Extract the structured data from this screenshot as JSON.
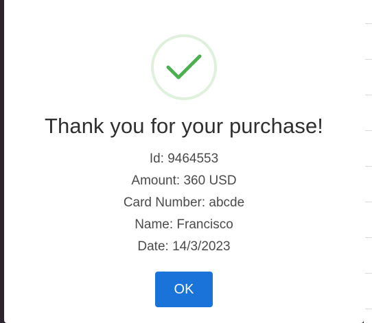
{
  "dialog": {
    "icon": "checkmark-icon",
    "title": "Thank you for your purchase!",
    "details": [
      {
        "text": "Id: 9464553"
      },
      {
        "text": "Amount: 360 USD"
      },
      {
        "text": "Card Number: abcde"
      },
      {
        "text": "Name: Francisco"
      },
      {
        "text": "Date: 14/3/2023"
      }
    ],
    "ok_label": "OK"
  },
  "colors": {
    "success": "#4caf50",
    "success_ring": "#dff0dc",
    "primary": "#1a73d8"
  }
}
